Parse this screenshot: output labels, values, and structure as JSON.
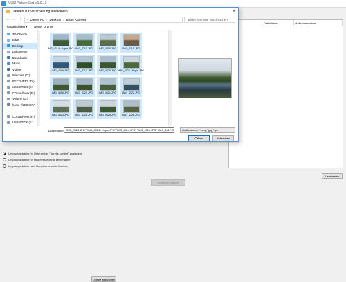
{
  "app": {
    "title": "VLSI PictureSort V1.0.12",
    "table_headers": [
      "Status",
      "Dateidatum",
      "Aufnahmedatum"
    ],
    "choose_folder_button": "Ordner auswählen",
    "options": [
      "Ursprungsdateien in Unterordner \"bereits sortiert\" auslagern",
      "Ursprungsdateien in Hauptverzeichnis beibehalten",
      "Ursprungsdateien aus Hauptverzeichnis löschen"
    ],
    "start_button": "Sortieren Starten",
    "load_list_button": "Liste leeren"
  },
  "dialog": {
    "title": "Dateien zur Verarbeitung auswählen",
    "breadcrumb": [
      "Dieser PC",
      "Desktop",
      "Bilder Kamera"
    ],
    "search_placeholder": "\"Bilder Kamera\" durchsuchen",
    "toolbar": {
      "organize": "Organisieren ▾",
      "new_folder": "Neuer Ordner"
    },
    "nav_items": [
      {
        "label": "3D-Objekte",
        "icon": "cube-icon",
        "color": "#6aa8e0"
      },
      {
        "label": "Bilder",
        "icon": "pictures-icon",
        "color": "#7fb7e8"
      },
      {
        "label": "Desktop",
        "icon": "desktop-icon",
        "color": "#3b8ed8"
      },
      {
        "label": "Dokumente",
        "icon": "documents-icon",
        "color": "#9aa7b5"
      },
      {
        "label": "Downloads",
        "icon": "downloads-icon",
        "color": "#2f7fd1"
      },
      {
        "label": "Musik",
        "icon": "music-icon",
        "color": "#4a90d9"
      },
      {
        "label": "Videos",
        "icon": "videos-icon",
        "color": "#5c6f86"
      },
      {
        "label": "Windows (C:)",
        "icon": "drive-icon",
        "color": "#8a9aaa"
      },
      {
        "label": "RECOVERY (D:)",
        "icon": "drive-icon",
        "color": "#8a9aaa"
      },
      {
        "label": "USB-STICK (E:)",
        "icon": "usb-drive-icon",
        "color": "#8a9aaa"
      },
      {
        "label": "CD-Laufwerk (F:)",
        "icon": "cd-drive-icon",
        "color": "#8a9aaa"
      },
      {
        "label": "Volume (G:)",
        "icon": "drive-icon",
        "color": "#8a9aaa"
      },
      {
        "label": "home (\\\\DISKSTA",
        "icon": "network-drive-icon",
        "color": "#6f8096"
      },
      {
        "label": "",
        "icon": "",
        "color": "#ffffff"
      },
      {
        "label": "CD-Laufwerk (F:)",
        "icon": "cd-drive-icon",
        "color": "#8a9aaa"
      },
      {
        "label": "USB-STICK (E:)",
        "icon": "usb-drive-icon",
        "color": "#8a9aaa"
      }
    ],
    "selected_nav_index": 2,
    "thumbnails": [
      {
        "label": "IMG_4314 - Kopie.JPG",
        "colors": [
          "#9fb7c9",
          "#3e5b36"
        ]
      },
      {
        "label": "IMG_4314.JPG",
        "colors": [
          "#a6bdcc",
          "#4a6a3c"
        ]
      },
      {
        "label": "IMG_4315.JPG",
        "colors": [
          "#b9c9d3",
          "#5a6d45"
        ]
      },
      {
        "label": "IMG_4315.JPG",
        "colors": [
          "#c4a98a",
          "#6a5a4a"
        ]
      },
      {
        "label": "",
        "colors": [],
        "empty": true
      },
      {
        "label": "IMG_4316.JPG",
        "colors": [
          "#c6d6e2",
          "#2f5a7e"
        ]
      },
      {
        "label": "IMG_4317.JPG",
        "colors": [
          "#b4c6d4",
          "#2c4f2a"
        ]
      },
      {
        "label": "IMG_4320.JPG",
        "colors": [
          "#a9bfce",
          "#3a5630"
        ]
      },
      {
        "label": "IMG_4322 - Kopie.JPG",
        "colors": [
          "#cbd6dd",
          "#4c6a3a"
        ]
      },
      {
        "label": "",
        "colors": [],
        "empty": true
      },
      {
        "label": "IMG_4319.JPG",
        "colors": [
          "#9fb1bf",
          "#3c5a30"
        ]
      },
      {
        "label": "IMG_4320.JPG",
        "colors": [
          "#a4b6c4",
          "#37522d"
        ]
      },
      {
        "label": "IMG_4321.JPG",
        "colors": [
          "#b1c3cf",
          "#46603a"
        ]
      },
      {
        "label": "IMG_4322.JPG",
        "colors": [
          "#c0ced8",
          "#2f5364"
        ]
      },
      {
        "label": "",
        "colors": [],
        "empty": true
      },
      {
        "label": "IMG_4323.JPG",
        "colors": [
          "#d6dde2",
          "#5d6f55"
        ]
      },
      {
        "label": "IMG_4324.JPG",
        "colors": [
          "#bfcbd3",
          "#4a5f45"
        ]
      },
      {
        "label": "IMG_4325.JPG",
        "colors": [
          "#cdd5da",
          "#3e5a32"
        ]
      },
      {
        "label": "IMG_4326.JPG",
        "colors": [
          "#aebdc8",
          "#55633f"
        ]
      },
      {
        "label": "",
        "colors": [],
        "empty": true
      }
    ],
    "filename_label": "Dateiname:",
    "filename_value": "\"IMG_4323.JPG\" \"IMG_4314 - Kopie.JPG\" \"IMG_4314.JPG\" \"IMG_4315.JPG\" \"IMG_4317.JPG\" \"IMG_4",
    "filetype_value": "Grafikdateien (*.bmp;*.jpg;*.jpe",
    "open_button": "Öffnen",
    "cancel_button": "Abbrechen",
    "close_glyph": "✕"
  }
}
